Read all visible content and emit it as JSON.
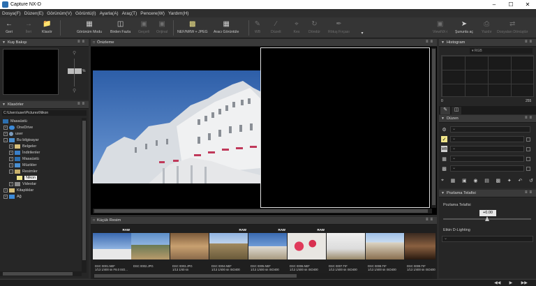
{
  "window": {
    "title": "Capture NX-D"
  },
  "menu": [
    "Dosya(F)",
    "Düzen(E)",
    "Görünüm(V)",
    "Görüntü(I)",
    "Ayarla(A)",
    "Araç(T)",
    "Pencere(W)",
    "Yardım(H)"
  ],
  "toolbar": {
    "back": "Geri",
    "forward": "İleri",
    "folder": "Klasör",
    "view_mode": "Görünüm Modu",
    "more_than_one": "Birden Fazla",
    "prev": "Geçerli",
    "original": "Orijinal",
    "format": "NEF/NRW + JPEG",
    "tool_view": "Aracı Görüntüle",
    "wb": "WB",
    "edit": "Düzelt",
    "crop": "Kes",
    "rotate": "Döndür",
    "retouch": "Rötuş Fırçası",
    "viewnx": "ViewNX-i",
    "open_with": "Şununla aç",
    "print": "Yazdır",
    "convert": "Dosyaları Dönüştür"
  },
  "left": {
    "navigator_title": "Kuş Bakışı",
    "zoom_value": "",
    "zoom_unit": "%",
    "folders_title": "Klasörler",
    "path": "C:\\Users\\user\\Pictures\\Nikon",
    "tree": [
      {
        "label": "Masaüstü",
        "level": 0
      },
      {
        "label": "OneDrive",
        "level": 1
      },
      {
        "label": "user",
        "level": 1
      },
      {
        "label": "Bu bilgisayar",
        "level": 1
      },
      {
        "label": "Belgeler",
        "level": 2
      },
      {
        "label": "İndirilenler",
        "level": 2
      },
      {
        "label": "Masaüstü",
        "level": 2
      },
      {
        "label": "Müzikler",
        "level": 2
      },
      {
        "label": "Resimler",
        "level": 2
      },
      {
        "label": "Nikon",
        "level": 3
      },
      {
        "label": "Videolar",
        "level": 2
      },
      {
        "label": "Kitaplıklar",
        "level": 1
      },
      {
        "label": "Ağ",
        "level": 1
      }
    ]
  },
  "viewer": {
    "title": "Önizleme"
  },
  "filmstrip": {
    "title": "Küçük Resim",
    "items": [
      {
        "name": "DSC 0001.NEF",
        "info": "1/13 1/400 sn F8.0 ISO...",
        "raw": "RAW"
      },
      {
        "name": "DSC 0002.JPG",
        "info": "",
        "raw": ""
      },
      {
        "name": "DSC 0003.JPG",
        "info": "1/13 1/40 sn",
        "raw": ""
      },
      {
        "name": "DSC 0004.NEF",
        "info": "1/13 1/400 sn ISO400",
        "raw": "RAW"
      },
      {
        "name": "DSC 0005.NEF",
        "info": "1/13 1/400 sn ISO400",
        "raw": "RAW"
      },
      {
        "name": "DSC 0006.NEF",
        "info": "1/13 1/400 sn ISO400",
        "raw": "RAW"
      },
      {
        "name": "DSC 0007.TIF",
        "info": "1/13 1/400 sn ISO400",
        "raw": ""
      },
      {
        "name": "DSC 0008.TIF",
        "info": "1/13 1/400 sn ISO400",
        "raw": ""
      },
      {
        "name": "DSC 0009.TIF",
        "info": "1/13 1/400 sn ISO400",
        "raw": ""
      }
    ]
  },
  "right": {
    "histogram_title": "Histogram",
    "histogram_channel": "RGB",
    "histogram_min": "0",
    "histogram_max": "255",
    "adjust_title": "Düzen",
    "exposure_title": "Pozlama Telafisi",
    "exposure_label": "Pozlama Telafisi",
    "exposure_value": "+0.00",
    "dlighting_label": "Etkin D-Lighting"
  },
  "colors": {
    "accent": "#f0e58a",
    "panel": "#262626",
    "header": "#3a3a3a"
  }
}
